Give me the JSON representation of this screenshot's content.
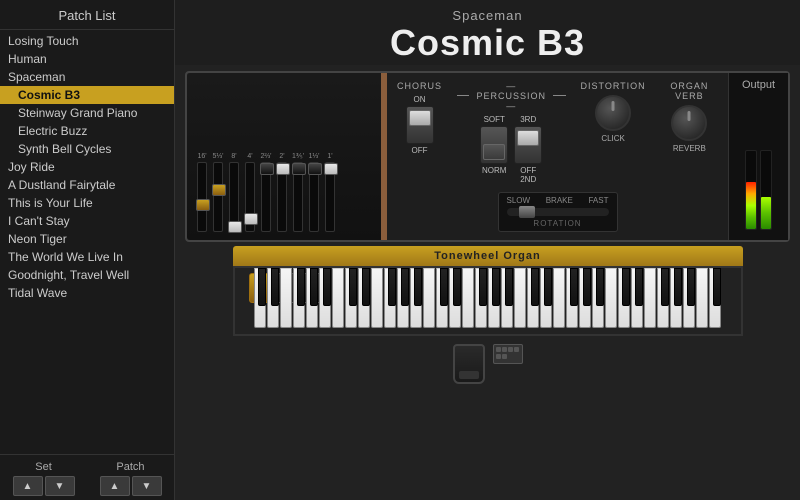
{
  "sidebar": {
    "header": "Patch List",
    "patches": [
      {
        "label": "Losing Touch",
        "selected": false,
        "sub": false
      },
      {
        "label": "Human",
        "selected": false,
        "sub": false
      },
      {
        "label": "Spaceman",
        "selected": false,
        "sub": false
      },
      {
        "label": "Cosmic B3",
        "selected": true,
        "sub": true
      },
      {
        "label": "Steinway Grand Piano",
        "selected": false,
        "sub": true
      },
      {
        "label": "Electric Buzz",
        "selected": false,
        "sub": true
      },
      {
        "label": "Synth Bell Cycles",
        "selected": false,
        "sub": true
      },
      {
        "label": "Joy Ride",
        "selected": false,
        "sub": false
      },
      {
        "label": "A Dustland Fairytale",
        "selected": false,
        "sub": false
      },
      {
        "label": "This is Your Life",
        "selected": false,
        "sub": false
      },
      {
        "label": "I Can't Stay",
        "selected": false,
        "sub": false
      },
      {
        "label": "Neon Tiger",
        "selected": false,
        "sub": false
      },
      {
        "label": "The World We Live In",
        "selected": false,
        "sub": false
      },
      {
        "label": "Goodnight, Travel Well",
        "selected": false,
        "sub": false
      },
      {
        "label": "Tidal Wave",
        "selected": false,
        "sub": false
      }
    ],
    "footer": {
      "set_label": "Set",
      "patch_label": "Patch",
      "btn_up": "▲",
      "btn_down": "▼"
    }
  },
  "main": {
    "instrument": "Spaceman",
    "patch": "Cosmic B3",
    "output_label": "Output",
    "keyboard_label": "Tonewheel Organ",
    "controls": {
      "chorus_label": "CHORUS",
      "chorus_on": "ON",
      "chorus_off": "OFF",
      "percussion_label": "— PERCUSSION —",
      "perc_soft_label": "SOFT",
      "perc_soft_norm": "NORM",
      "perc_3rd_label": "3RD",
      "perc_3rd_off": "OFF",
      "perc_3rd_2nd": "2ND",
      "distortion_label": "DISTORTION",
      "click_label": "CLICK",
      "organ_verb_label": "ORGAN VERB",
      "reverb_label": "REVERB",
      "rotation_slow": "SLOW",
      "rotation_brake": "BRAKE",
      "rotation_fast": "FAST",
      "rotation_sublabel": "ROTATION"
    },
    "drawbars": {
      "labels": [
        "16'",
        "5⅓'",
        "8'",
        "4'",
        "2⅔'",
        "2'",
        "1⅗'",
        "1⅓'",
        "1'"
      ],
      "positions": [
        5,
        3,
        8,
        7,
        0,
        0,
        0,
        0,
        0
      ]
    }
  }
}
